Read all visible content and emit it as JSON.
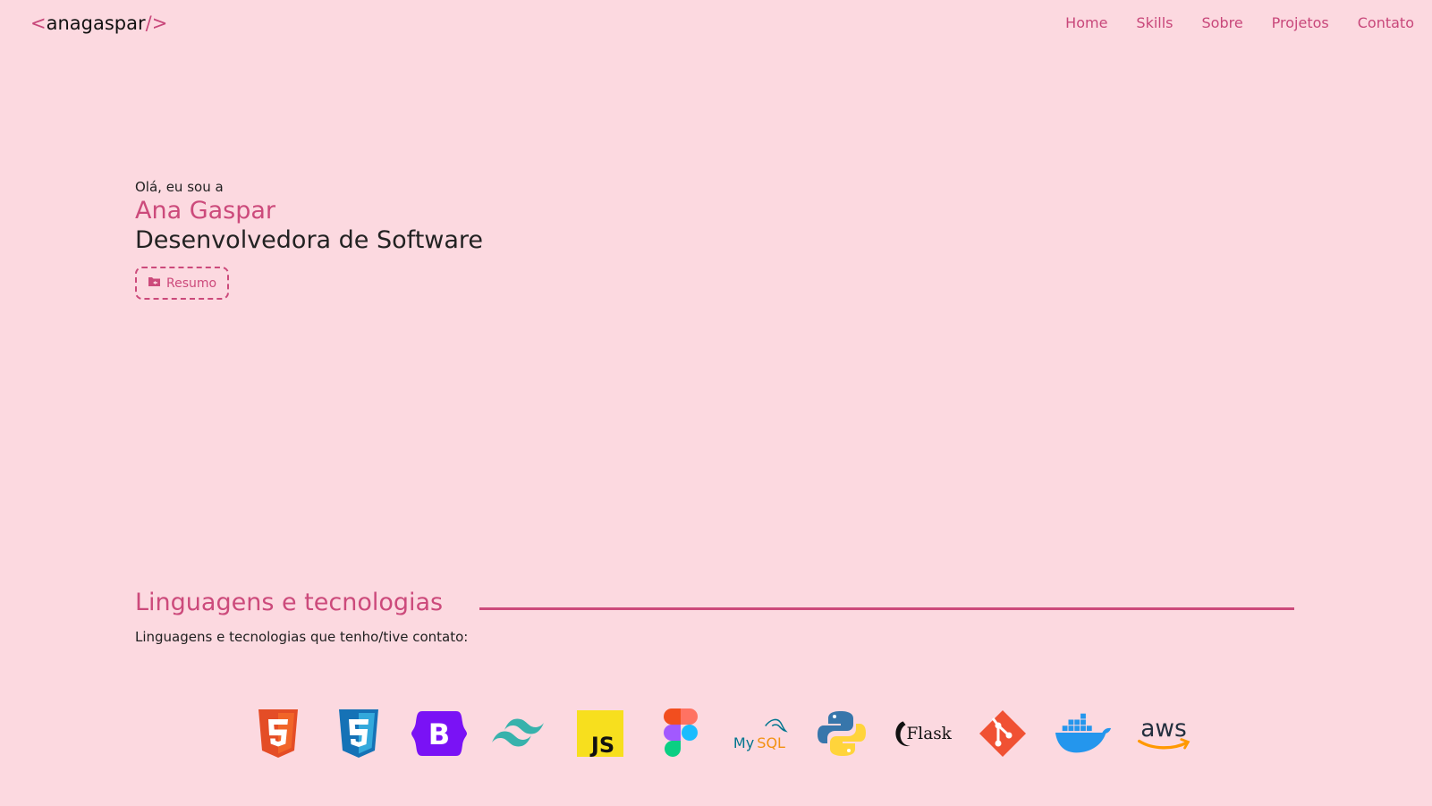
{
  "header": {
    "logo_open": "<",
    "logo_text": "anagaspar",
    "logo_close": "/>",
    "nav": [
      "Home",
      "Skills",
      "Sobre",
      "Projetos",
      "Contato"
    ]
  },
  "hero": {
    "greeting": "Olá, eu sou a",
    "name": "Ana Gaspar",
    "role": "Desenvolvedora de Software",
    "resume_label": "Resumo"
  },
  "skills": {
    "title": "Linguagens e tecnologias",
    "description": "Linguagens e tecnologias que tenho/tive contato:",
    "icons": [
      "html5-icon",
      "css3-icon",
      "bootstrap-icon",
      "tailwind-icon",
      "javascript-icon",
      "figma-icon",
      "mysql-icon",
      "python-icon",
      "flask-icon",
      "git-icon",
      "docker-icon",
      "aws-icon"
    ],
    "labels": {
      "bootstrap": "B",
      "javascript": "JS",
      "mysql_my": "My",
      "mysql_sql": "SQL",
      "flask": "Flask",
      "aws": "aws"
    }
  },
  "colors": {
    "background": "#fcd9e0",
    "accent": "#cc4a7b"
  }
}
